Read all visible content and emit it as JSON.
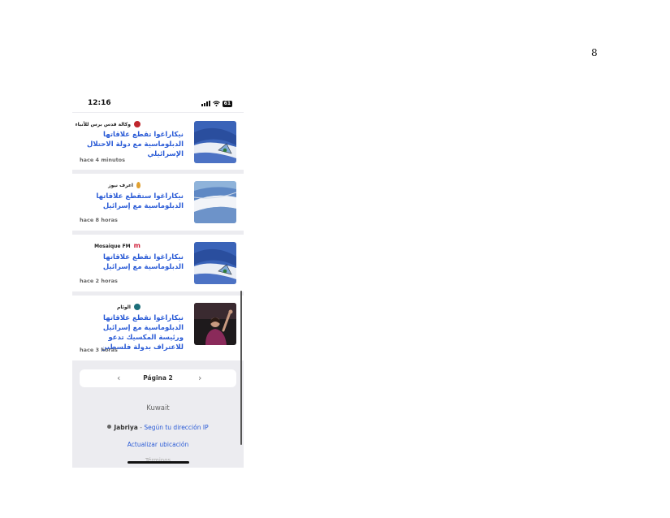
{
  "page": {
    "number": "8"
  },
  "status_bar": {
    "time": "12:16",
    "battery": "61"
  },
  "articles": [
    {
      "source": "وكالة قدس برس للأنباء",
      "source_color": "#c0262d",
      "headline": "نيكاراغوا تقطع علاقاتها الدبلوماسية مع دولة الاحتلال الإسرائيلي",
      "age": "hace 4 minutos",
      "thumb": "nicaragua-flag"
    },
    {
      "source": "اعرف نيوز",
      "source_color": "#e0a030",
      "headline": "نيكاراغوا ستقطع علاقاتها الدبلوماسية مع إسرائيل",
      "age": "hace 8 horas",
      "thumb": "nicaragua-flag-waving"
    },
    {
      "source": "Mosaique FM",
      "source_color": "#d0203a",
      "headline": "نيكاراغوا تقطع علاقاتها الدبلوماسية مع إسرائيل",
      "age": "hace 2 horas",
      "thumb": "nicaragua-flag"
    },
    {
      "source": "الوئام",
      "source_color": "#1d6f7a",
      "headline": "نيكاراغوا تقطع علاقاتها الدبلوماسية مع إسرائيل ورئيسة المكسيك تدعو للاعتراف بدولة فلسطين",
      "age": "hace 3 horas",
      "thumb": "speaker-photo"
    }
  ],
  "pagination": {
    "label": "Página 2",
    "prev_icon": "chevron-left-icon",
    "next_icon": "chevron-right-icon"
  },
  "footer": {
    "region": "Kuwait",
    "city": "Jabriya",
    "separator": " - ",
    "ip_text": "Según tu dirección IP",
    "update_link": "Actualizar ubicación",
    "terms": "Términos"
  }
}
